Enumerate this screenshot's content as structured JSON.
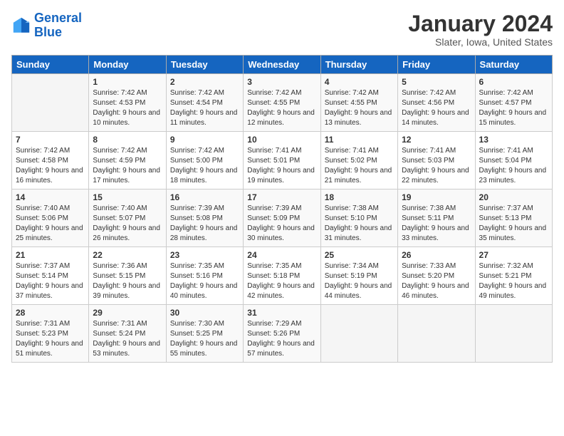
{
  "header": {
    "logo_line1": "General",
    "logo_line2": "Blue",
    "month_title": "January 2024",
    "subtitle": "Slater, Iowa, United States"
  },
  "days_of_week": [
    "Sunday",
    "Monday",
    "Tuesday",
    "Wednesday",
    "Thursday",
    "Friday",
    "Saturday"
  ],
  "weeks": [
    [
      {
        "day": "",
        "sunrise": "",
        "sunset": "",
        "daylight": ""
      },
      {
        "day": "1",
        "sunrise": "Sunrise: 7:42 AM",
        "sunset": "Sunset: 4:53 PM",
        "daylight": "Daylight: 9 hours and 10 minutes."
      },
      {
        "day": "2",
        "sunrise": "Sunrise: 7:42 AM",
        "sunset": "Sunset: 4:54 PM",
        "daylight": "Daylight: 9 hours and 11 minutes."
      },
      {
        "day": "3",
        "sunrise": "Sunrise: 7:42 AM",
        "sunset": "Sunset: 4:55 PM",
        "daylight": "Daylight: 9 hours and 12 minutes."
      },
      {
        "day": "4",
        "sunrise": "Sunrise: 7:42 AM",
        "sunset": "Sunset: 4:55 PM",
        "daylight": "Daylight: 9 hours and 13 minutes."
      },
      {
        "day": "5",
        "sunrise": "Sunrise: 7:42 AM",
        "sunset": "Sunset: 4:56 PM",
        "daylight": "Daylight: 9 hours and 14 minutes."
      },
      {
        "day": "6",
        "sunrise": "Sunrise: 7:42 AM",
        "sunset": "Sunset: 4:57 PM",
        "daylight": "Daylight: 9 hours and 15 minutes."
      }
    ],
    [
      {
        "day": "7",
        "sunrise": "Sunrise: 7:42 AM",
        "sunset": "Sunset: 4:58 PM",
        "daylight": "Daylight: 9 hours and 16 minutes."
      },
      {
        "day": "8",
        "sunrise": "Sunrise: 7:42 AM",
        "sunset": "Sunset: 4:59 PM",
        "daylight": "Daylight: 9 hours and 17 minutes."
      },
      {
        "day": "9",
        "sunrise": "Sunrise: 7:42 AM",
        "sunset": "Sunset: 5:00 PM",
        "daylight": "Daylight: 9 hours and 18 minutes."
      },
      {
        "day": "10",
        "sunrise": "Sunrise: 7:41 AM",
        "sunset": "Sunset: 5:01 PM",
        "daylight": "Daylight: 9 hours and 19 minutes."
      },
      {
        "day": "11",
        "sunrise": "Sunrise: 7:41 AM",
        "sunset": "Sunset: 5:02 PM",
        "daylight": "Daylight: 9 hours and 21 minutes."
      },
      {
        "day": "12",
        "sunrise": "Sunrise: 7:41 AM",
        "sunset": "Sunset: 5:03 PM",
        "daylight": "Daylight: 9 hours and 22 minutes."
      },
      {
        "day": "13",
        "sunrise": "Sunrise: 7:41 AM",
        "sunset": "Sunset: 5:04 PM",
        "daylight": "Daylight: 9 hours and 23 minutes."
      }
    ],
    [
      {
        "day": "14",
        "sunrise": "Sunrise: 7:40 AM",
        "sunset": "Sunset: 5:06 PM",
        "daylight": "Daylight: 9 hours and 25 minutes."
      },
      {
        "day": "15",
        "sunrise": "Sunrise: 7:40 AM",
        "sunset": "Sunset: 5:07 PM",
        "daylight": "Daylight: 9 hours and 26 minutes."
      },
      {
        "day": "16",
        "sunrise": "Sunrise: 7:39 AM",
        "sunset": "Sunset: 5:08 PM",
        "daylight": "Daylight: 9 hours and 28 minutes."
      },
      {
        "day": "17",
        "sunrise": "Sunrise: 7:39 AM",
        "sunset": "Sunset: 5:09 PM",
        "daylight": "Daylight: 9 hours and 30 minutes."
      },
      {
        "day": "18",
        "sunrise": "Sunrise: 7:38 AM",
        "sunset": "Sunset: 5:10 PM",
        "daylight": "Daylight: 9 hours and 31 minutes."
      },
      {
        "day": "19",
        "sunrise": "Sunrise: 7:38 AM",
        "sunset": "Sunset: 5:11 PM",
        "daylight": "Daylight: 9 hours and 33 minutes."
      },
      {
        "day": "20",
        "sunrise": "Sunrise: 7:37 AM",
        "sunset": "Sunset: 5:13 PM",
        "daylight": "Daylight: 9 hours and 35 minutes."
      }
    ],
    [
      {
        "day": "21",
        "sunrise": "Sunrise: 7:37 AM",
        "sunset": "Sunset: 5:14 PM",
        "daylight": "Daylight: 9 hours and 37 minutes."
      },
      {
        "day": "22",
        "sunrise": "Sunrise: 7:36 AM",
        "sunset": "Sunset: 5:15 PM",
        "daylight": "Daylight: 9 hours and 39 minutes."
      },
      {
        "day": "23",
        "sunrise": "Sunrise: 7:35 AM",
        "sunset": "Sunset: 5:16 PM",
        "daylight": "Daylight: 9 hours and 40 minutes."
      },
      {
        "day": "24",
        "sunrise": "Sunrise: 7:35 AM",
        "sunset": "Sunset: 5:18 PM",
        "daylight": "Daylight: 9 hours and 42 minutes."
      },
      {
        "day": "25",
        "sunrise": "Sunrise: 7:34 AM",
        "sunset": "Sunset: 5:19 PM",
        "daylight": "Daylight: 9 hours and 44 minutes."
      },
      {
        "day": "26",
        "sunrise": "Sunrise: 7:33 AM",
        "sunset": "Sunset: 5:20 PM",
        "daylight": "Daylight: 9 hours and 46 minutes."
      },
      {
        "day": "27",
        "sunrise": "Sunrise: 7:32 AM",
        "sunset": "Sunset: 5:21 PM",
        "daylight": "Daylight: 9 hours and 49 minutes."
      }
    ],
    [
      {
        "day": "28",
        "sunrise": "Sunrise: 7:31 AM",
        "sunset": "Sunset: 5:23 PM",
        "daylight": "Daylight: 9 hours and 51 minutes."
      },
      {
        "day": "29",
        "sunrise": "Sunrise: 7:31 AM",
        "sunset": "Sunset: 5:24 PM",
        "daylight": "Daylight: 9 hours and 53 minutes."
      },
      {
        "day": "30",
        "sunrise": "Sunrise: 7:30 AM",
        "sunset": "Sunset: 5:25 PM",
        "daylight": "Daylight: 9 hours and 55 minutes."
      },
      {
        "day": "31",
        "sunrise": "Sunrise: 7:29 AM",
        "sunset": "Sunset: 5:26 PM",
        "daylight": "Daylight: 9 hours and 57 minutes."
      },
      {
        "day": "",
        "sunrise": "",
        "sunset": "",
        "daylight": ""
      },
      {
        "day": "",
        "sunrise": "",
        "sunset": "",
        "daylight": ""
      },
      {
        "day": "",
        "sunrise": "",
        "sunset": "",
        "daylight": ""
      }
    ]
  ]
}
